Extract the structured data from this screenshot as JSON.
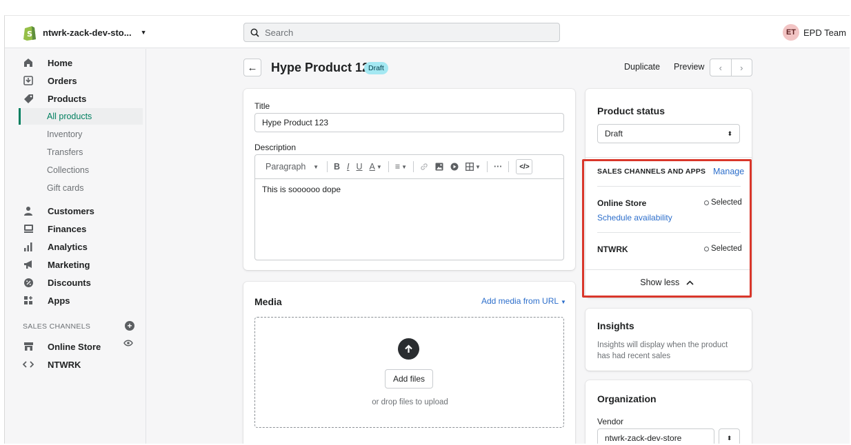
{
  "topbar": {
    "store_name": "ntwrk-zack-dev-sto...",
    "search_placeholder": "Search",
    "user_initials": "ET",
    "user_name": "EPD Team"
  },
  "sidebar": {
    "items": [
      {
        "label": "Home",
        "icon": "home-icon"
      },
      {
        "label": "Orders",
        "icon": "orders-icon"
      },
      {
        "label": "Products",
        "icon": "tag-icon"
      },
      {
        "label": "Customers",
        "icon": "person-icon"
      },
      {
        "label": "Finances",
        "icon": "finances-icon"
      },
      {
        "label": "Analytics",
        "icon": "bar-chart-icon"
      },
      {
        "label": "Marketing",
        "icon": "megaphone-icon"
      },
      {
        "label": "Discounts",
        "icon": "discount-icon"
      },
      {
        "label": "Apps",
        "icon": "apps-icon"
      }
    ],
    "product_subitems": [
      "All products",
      "Inventory",
      "Transfers",
      "Collections",
      "Gift cards"
    ],
    "active_subitem": "All products",
    "sales_channels_label": "SALES CHANNELS",
    "channels": [
      {
        "label": "Online Store",
        "icon": "store-icon"
      },
      {
        "label": "NTWRK",
        "icon": "code-icon"
      }
    ]
  },
  "page": {
    "title": "Hype Product 123",
    "badge": "Draft",
    "duplicate_label": "Duplicate",
    "preview_label": "Preview"
  },
  "details": {
    "title_label": "Title",
    "title_value": "Hype Product 123",
    "description_label": "Description",
    "format_option": "Paragraph",
    "description_text": "This is soooooo dope"
  },
  "media": {
    "title": "Media",
    "add_from_url": "Add media from URL",
    "add_files": "Add files",
    "drop_hint": "or drop files to upload"
  },
  "status": {
    "title": "Product status",
    "value": "Draft"
  },
  "sales_channels": {
    "heading": "SALES CHANNELS AND APPS",
    "manage": "Manage",
    "channels": [
      {
        "name": "Online Store",
        "status": "Selected"
      },
      {
        "name": "NTWRK",
        "status": "Selected"
      }
    ],
    "schedule": "Schedule availability",
    "show_less": "Show less"
  },
  "insights": {
    "title": "Insights",
    "text_line1": "Insights will display when the product",
    "text_line2": "has had recent sales"
  },
  "organization": {
    "title": "Organization",
    "vendor_label": "Vendor",
    "vendor_value": "ntwrk-zack-dev-store"
  },
  "colors": {
    "accent_green": "#007f5f",
    "link_blue": "#2c6ecb",
    "highlight_red": "#d9362a",
    "badge_blue": "#a4e8f2"
  }
}
